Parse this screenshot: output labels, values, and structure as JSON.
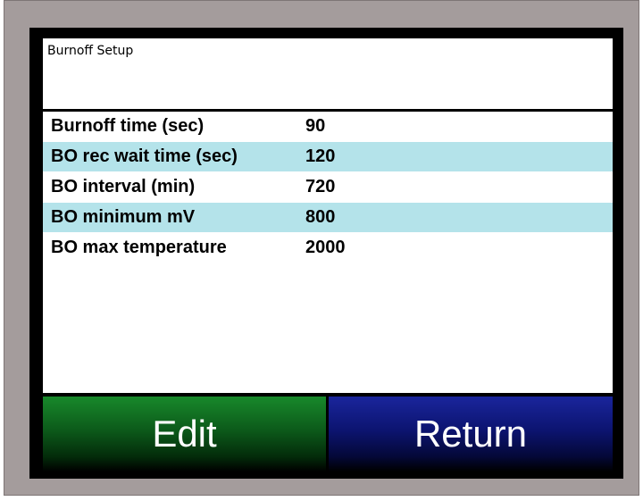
{
  "header": {
    "title": "Burnoff Setup"
  },
  "settings": [
    {
      "label": "Burnoff time (sec)",
      "value": "90"
    },
    {
      "label": "BO rec wait time (sec)",
      "value": "120"
    },
    {
      "label": "BO interval (min)",
      "value": "720"
    },
    {
      "label": "BO minimum mV",
      "value": "800"
    },
    {
      "label": "BO max temperature",
      "value": "2000"
    }
  ],
  "buttons": {
    "edit": "Edit",
    "return": "Return"
  },
  "colors": {
    "bezel": "#a49c9c",
    "row_highlight": "#b4e3ea",
    "edit_button": "#18892b",
    "return_button": "#1a259c"
  }
}
